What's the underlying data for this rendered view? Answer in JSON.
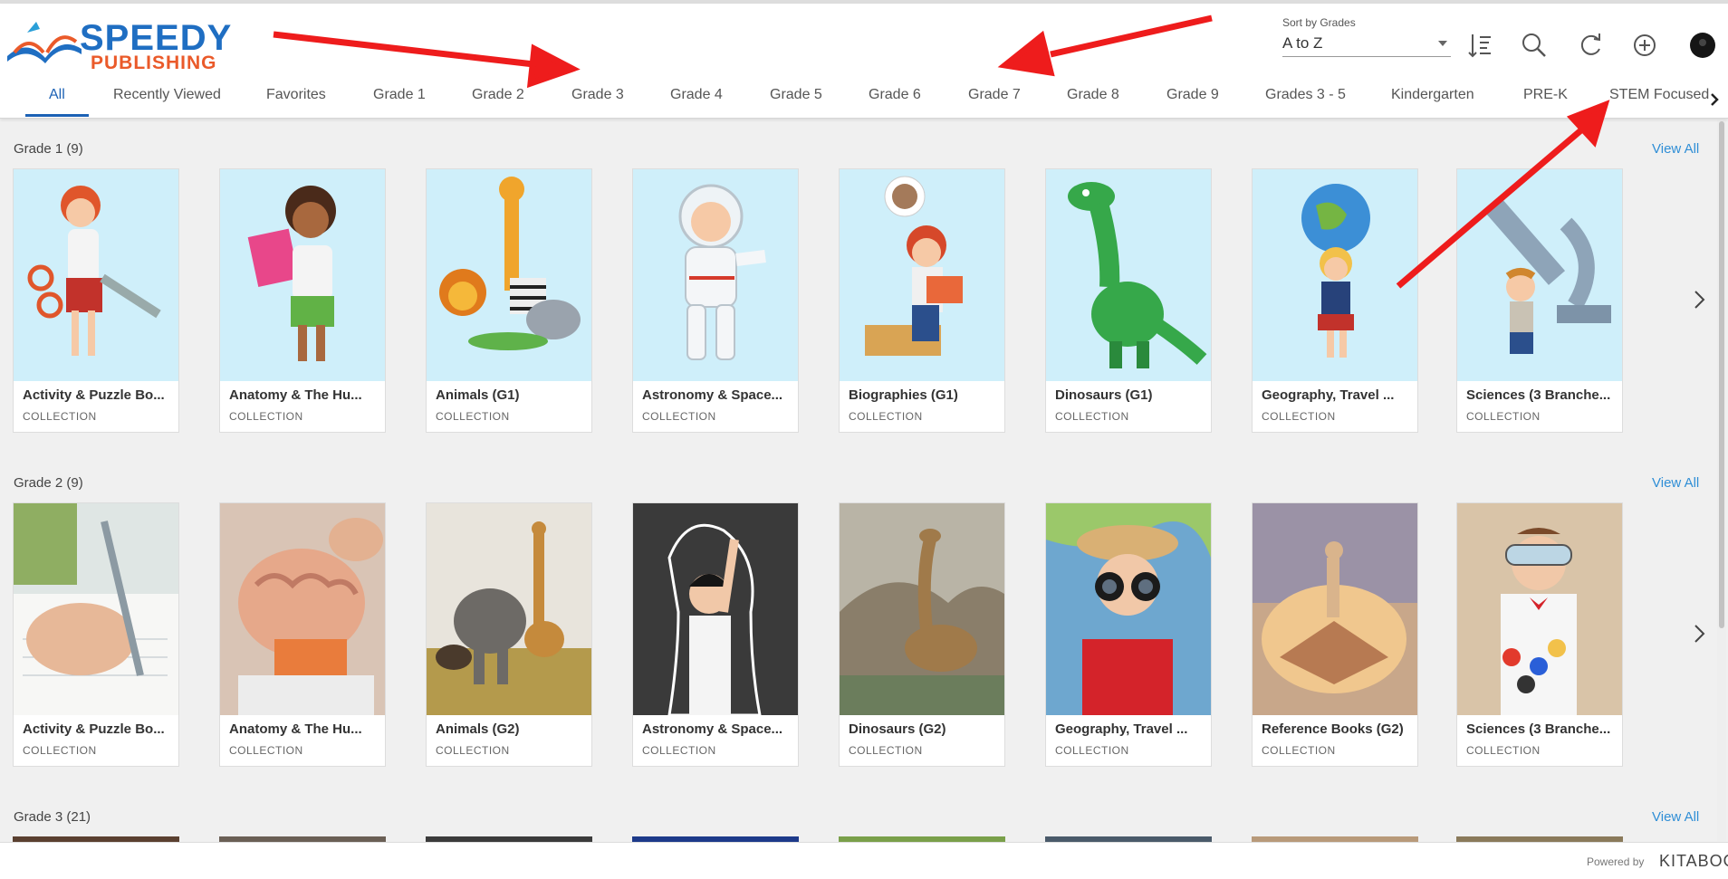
{
  "brand": {
    "line1": "SPEEDY",
    "line2": "PUBLISHING"
  },
  "sort": {
    "label": "Sort by Grades",
    "value": "A to Z"
  },
  "header_icons": [
    "sort-order-icon",
    "search-icon",
    "refresh-icon",
    "add-icon",
    "avatar"
  ],
  "tabs": [
    "All",
    "Recently Viewed",
    "Favorites",
    "Grade 1",
    "Grade 2",
    "Grade 3",
    "Grade 4",
    "Grade 5",
    "Grade 6",
    "Grade 7",
    "Grade 8",
    "Grade 9",
    "Grades 3 - 5",
    "Kindergarten",
    "PRE-K",
    "STEM Focused"
  ],
  "active_tab": "All",
  "view_all": "View All",
  "collection_label": "COLLECTION",
  "sections": [
    {
      "title": "Grade 1 (9)",
      "cards": [
        {
          "title": "Activity & Puzzle Bo...",
          "sub": "COLLECTION"
        },
        {
          "title": "Anatomy & The Hu...",
          "sub": "COLLECTION"
        },
        {
          "title": "Animals (G1)",
          "sub": "COLLECTION"
        },
        {
          "title": "Astronomy & Space...",
          "sub": "COLLECTION"
        },
        {
          "title": "Biographies (G1)",
          "sub": "COLLECTION"
        },
        {
          "title": "Dinosaurs (G1)",
          "sub": "COLLECTION"
        },
        {
          "title": "Geography, Travel ...",
          "sub": "COLLECTION"
        },
        {
          "title": "Sciences (3 Branche...",
          "sub": "COLLECTION"
        }
      ]
    },
    {
      "title": "Grade 2 (9)",
      "cards": [
        {
          "title": "Activity & Puzzle Bo...",
          "sub": "COLLECTION"
        },
        {
          "title": "Anatomy & The Hu...",
          "sub": "COLLECTION"
        },
        {
          "title": "Animals (G2)",
          "sub": "COLLECTION"
        },
        {
          "title": "Astronomy & Space...",
          "sub": "COLLECTION"
        },
        {
          "title": "Dinosaurs (G2)",
          "sub": "COLLECTION"
        },
        {
          "title": "Geography, Travel ...",
          "sub": "COLLECTION"
        },
        {
          "title": "Reference Books (G2)",
          "sub": "COLLECTION"
        },
        {
          "title": "Sciences (3 Branche...",
          "sub": "COLLECTION"
        }
      ]
    },
    {
      "title": "Grade 3 (21)",
      "cards": []
    }
  ],
  "footer": {
    "powered": "Powered by",
    "brand": "KITABOO"
  },
  "colors": {
    "accent": "#1d62b5",
    "link": "#2f8ed6",
    "annotation": "#ee1c1c",
    "card_bg_g1": "#cfeffa"
  }
}
